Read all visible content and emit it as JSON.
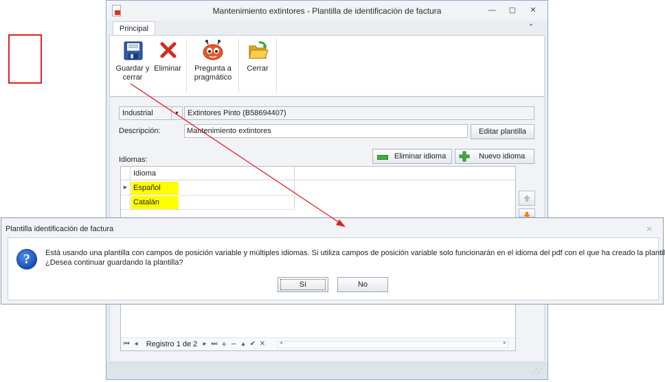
{
  "window": {
    "title": "Mantenimiento extintores - Plantilla de identificación de factura",
    "controls": {
      "minimize": "—",
      "restore": "▢",
      "close": "✕"
    }
  },
  "ribbon": {
    "tab": "Principal",
    "collapse": "⌃",
    "buttons": {
      "save": "Guardar y cerrar",
      "delete": "Eliminar",
      "ask": "Pregunta a pragmático",
      "close": "Cerrar"
    }
  },
  "form": {
    "category": "Industrial",
    "company": "Extintores Pinto (B58694407)",
    "description_label": "Descripción:",
    "description_value": "Mantenimiento extintores",
    "edit_template": "Editar plantilla",
    "languages_label": "Idiomas:",
    "remove_language": "Eliminar idioma",
    "new_language": "Nuevo idioma"
  },
  "grid": {
    "column": "Idioma",
    "rows": [
      "Español",
      "Catalán"
    ],
    "nav": {
      "record_text": "Registro 1 de 2"
    }
  },
  "dialog": {
    "title": "Plantilla identificación de factura",
    "message_line1": "Está usando una plantilla con campos de posición variable y múltiples idiomas. Si utiliza campos de posición variable solo funcionarán en el idioma del pdf con el que ha creado la plantilla.",
    "message_line2": "¿Desea continuar guardando la plantilla?",
    "yes": "Sí",
    "no": "No"
  },
  "colors": {
    "highlight": "#ffff00",
    "annotation_red": "#e0211f",
    "question_blue": "#1a4fb5"
  }
}
